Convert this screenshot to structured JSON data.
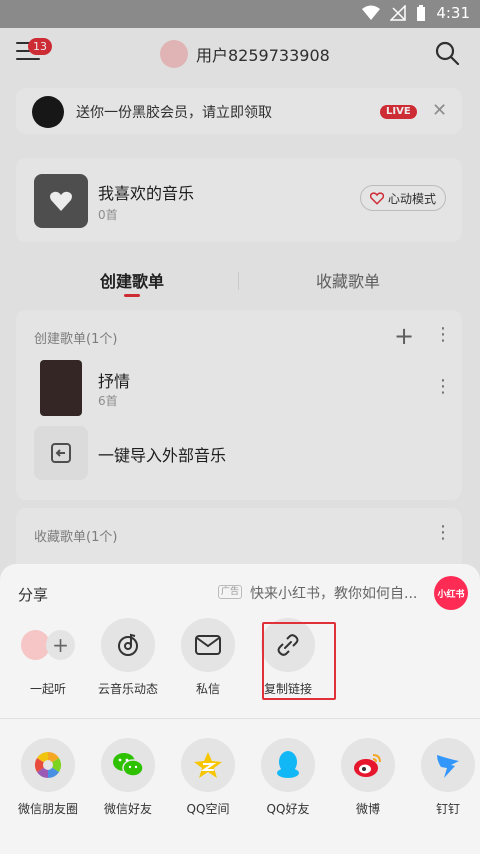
{
  "status_bar": {
    "time": "4:31"
  },
  "header": {
    "menu_badge": "13",
    "user_name": "用户8259733908"
  },
  "promo": {
    "text": "送你一份黑胶会员，请立即领取",
    "live_label": "LIVE",
    "close": "✕"
  },
  "favorites": {
    "title": "我喜欢的音乐",
    "count": "0首",
    "mode_button": "心动模式"
  },
  "tabs": {
    "created": "创建歌单",
    "collected": "收藏歌单"
  },
  "created_section": {
    "label": "创建歌单(1个)",
    "playlists": [
      {
        "title": "抒情",
        "count": "6首"
      }
    ],
    "import_label": "一键导入外部音乐"
  },
  "collected_section": {
    "label": "收藏歌单(1个)"
  },
  "share_sheet": {
    "title": "分享",
    "ad_tag": "广告",
    "ad_text": "快来小红书，教你如何自...",
    "ad_logo": "小红书",
    "row1": [
      {
        "label": "一起听",
        "icon": "listen-together-icon"
      },
      {
        "label": "云音乐动态",
        "icon": "music-feed-icon"
      },
      {
        "label": "私信",
        "icon": "mail-icon"
      },
      {
        "label": "复制链接",
        "icon": "link-icon"
      }
    ],
    "row2": [
      {
        "label": "微信朋友圈",
        "icon": "wechat-moments-icon"
      },
      {
        "label": "微信好友",
        "icon": "wechat-icon"
      },
      {
        "label": "QQ空间",
        "icon": "qzone-icon"
      },
      {
        "label": "QQ好友",
        "icon": "qq-icon"
      },
      {
        "label": "微博",
        "icon": "weibo-icon"
      },
      {
        "label": "钉钉",
        "icon": "dingtalk-icon"
      }
    ]
  }
}
